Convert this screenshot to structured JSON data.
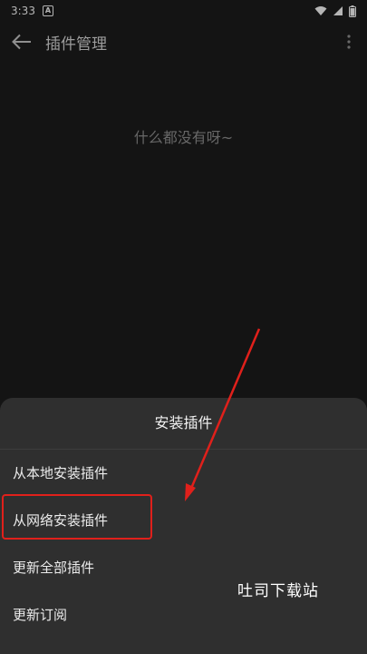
{
  "status_bar": {
    "time": "3:33",
    "notification_letter": "A"
  },
  "app_bar": {
    "title": "插件管理"
  },
  "empty_state": {
    "message": "什么都没有呀~"
  },
  "sheet": {
    "title": "安装插件",
    "items": [
      {
        "label": "从本地安装插件"
      },
      {
        "label": "从网络安装插件"
      },
      {
        "label": "更新全部插件"
      },
      {
        "label": "更新订阅"
      }
    ]
  },
  "watermark": "吐司下载站",
  "colors": {
    "background": "#1b1b1b",
    "sheet": "#2f2f2f",
    "highlight": "#e0201b"
  }
}
